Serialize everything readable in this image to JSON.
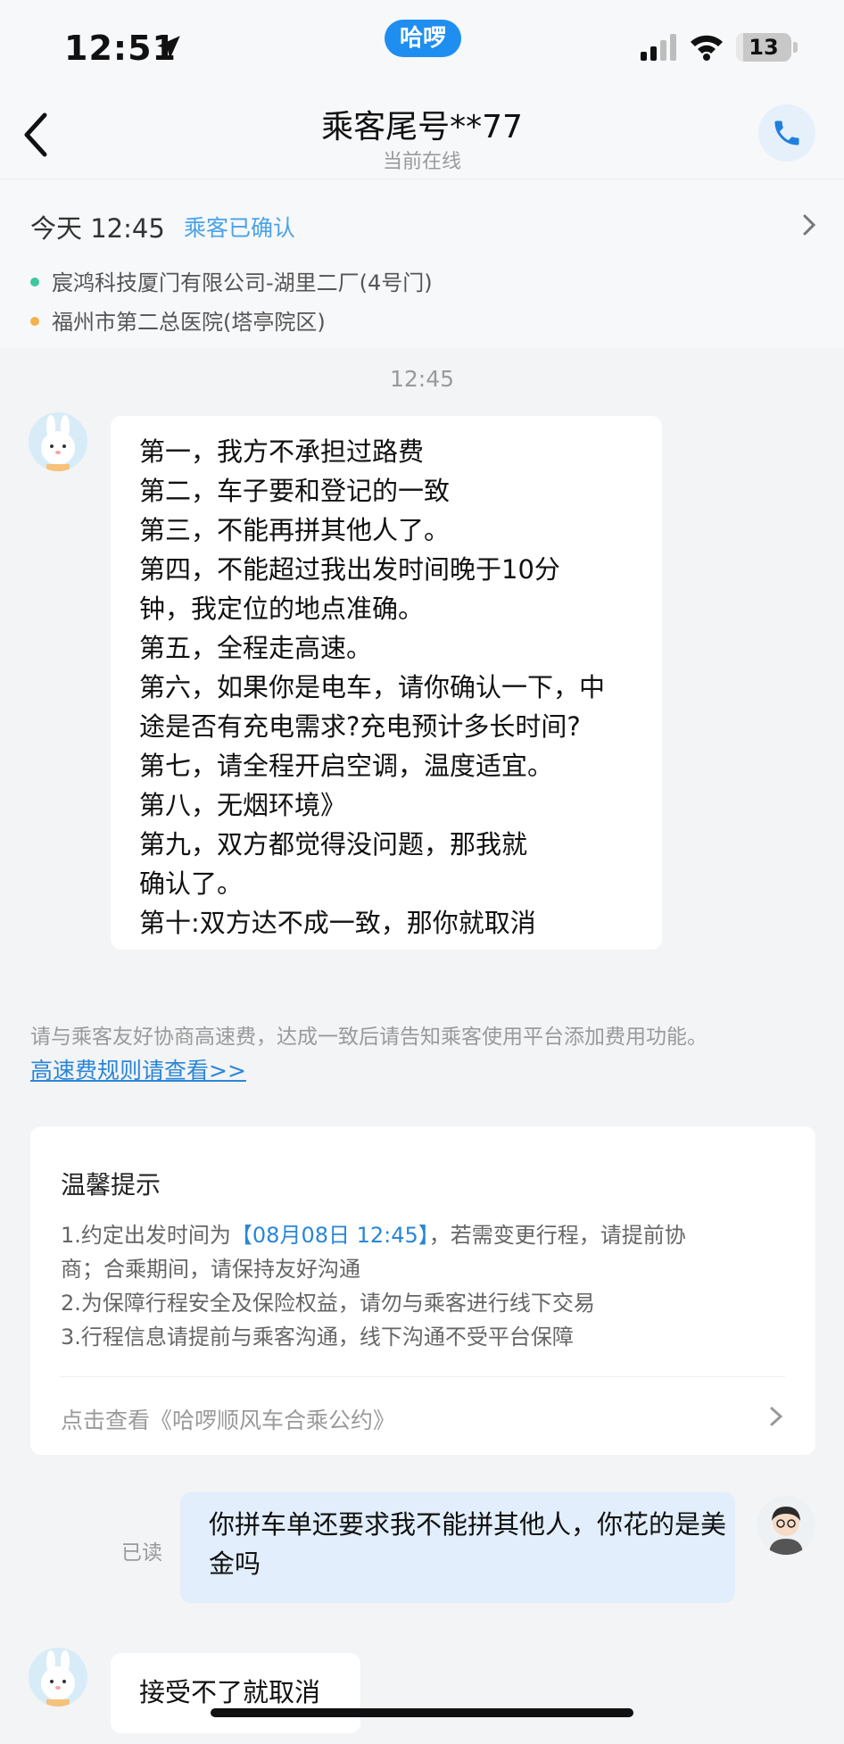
{
  "status_bar": {
    "time": "12:51",
    "app_pill": "哈啰",
    "battery": "13",
    "battery_level": 0.13
  },
  "header": {
    "title": "乘客尾号**77",
    "subtitle": "当前在线"
  },
  "trip": {
    "time": "今天 12:45",
    "status": "乘客已确认",
    "origin": "宸鸿科技厦门有限公司-湖里二厂(4号门)",
    "destination": "福州市第二总医院(塔亭院区)",
    "origin_color": "#3cc7a0",
    "destination_color": "#f5b14a"
  },
  "chat": {
    "timestamp": "12:45",
    "passenger_message_lines": [
      "第一，我方不承担过路费",
      "第二，车子要和登记的一致",
      "第三，不能再拼其他人了。",
      "第四，不能超过我出发时间晚于10分",
      "钟，我定位的地点准确。",
      "第五，全程走高速。",
      "第六，如果你是电车，请你确认一下，中",
      "途是否有充电需求?充电预计多长时间?",
      "第七，请全程开启空调，温度适宜。",
      "第八，无烟环境》",
      "第九，双方都觉得没问题，那我就",
      "确认了。",
      "第十:双方达不成一致，那你就取消"
    ],
    "system_notice": "请与乘客友好协商高速费，达成一致后请告知乘客使用平台添加费用功能。",
    "system_link": "高速费规则请查看>>",
    "tips": {
      "title": "温馨提示",
      "line1_prefix": "1.约定出发时间为",
      "line1_highlight": "【08月08日 12:45】",
      "line1_suffix": "，若需变更行程，请提前协",
      "line1_cont": "商；合乘期间，请保持友好沟通",
      "line2": "2.为保障行程安全及保险权益，请勿与乘客进行线下交易",
      "line3": "3.行程信息请提前与乘客沟通，线下沟通不受平台保障",
      "link": "点击查看《哈啰顺风车合乘公约》"
    },
    "read_status": "已读",
    "driver_message_lines": [
      "你拼车单还要求我不能拼其他人，你花的",
      "是美金吗"
    ],
    "passenger_reply": "接受不了就取消"
  }
}
